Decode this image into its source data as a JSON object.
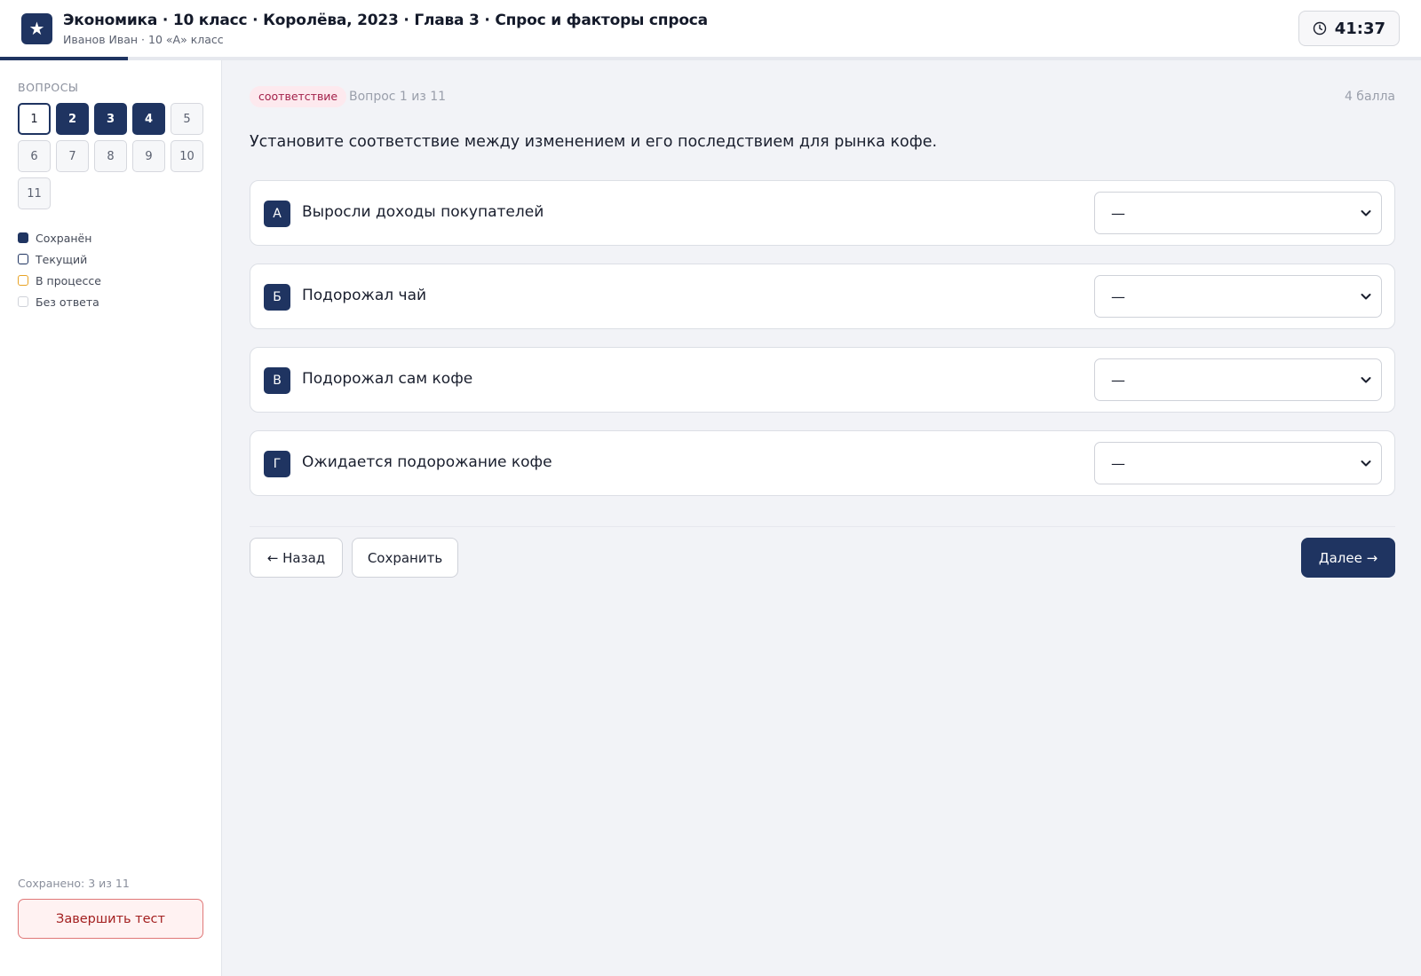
{
  "header": {
    "logo_glyph": "★",
    "title": "Экономика · 10 класс · Королёва, 2023 · Глава 3 · Спрос и факторы спроса",
    "subtitle": "Иванов Иван · 10 «А» класс",
    "timer": "41:37",
    "progress_fraction": 0.09
  },
  "sidebar": {
    "heading": "ВОПРОСЫ",
    "questions": [
      {
        "label": "1",
        "state": "current"
      },
      {
        "label": "2",
        "state": "saved"
      },
      {
        "label": "3",
        "state": "saved"
      },
      {
        "label": "4",
        "state": "saved"
      },
      {
        "label": "5",
        "state": "empty"
      },
      {
        "label": "6",
        "state": "empty"
      },
      {
        "label": "7",
        "state": "empty"
      },
      {
        "label": "8",
        "state": "empty"
      },
      {
        "label": "9",
        "state": "empty"
      },
      {
        "label": "10",
        "state": "empty"
      },
      {
        "label": "11",
        "state": "empty"
      }
    ],
    "legend": {
      "saved": "Сохранён",
      "current": "Текущий",
      "in_progress": "В процессе",
      "no_answer": "Без ответа"
    },
    "saved_count": "Сохранено: 3 из 11",
    "finish_label": "Завершить тест"
  },
  "main": {
    "tag": "соответствие",
    "question_number": "Вопрос 1 из 11",
    "points": "4 балла",
    "question_text": "Установите соответствие между изменением и его последствием для рынка кофе.",
    "items": [
      {
        "letter": "А",
        "text": "Выросли доходы покупателей",
        "selected": "—"
      },
      {
        "letter": "Б",
        "text": "Подорожал чай",
        "selected": "—"
      },
      {
        "letter": "В",
        "text": "Подорожал сам кофе",
        "selected": "—"
      },
      {
        "letter": "Г",
        "text": "Ожидается подорожание кофе",
        "selected": "—"
      }
    ],
    "back_label": "← Назад",
    "save_label": "Сохранить",
    "next_label": "Далее →"
  },
  "colors": {
    "accent": "#1f3461",
    "tag_bg": "#fde9ee",
    "tag_text": "#a3214a",
    "in_progress": "#e8a325",
    "danger": "#a31f1f"
  }
}
